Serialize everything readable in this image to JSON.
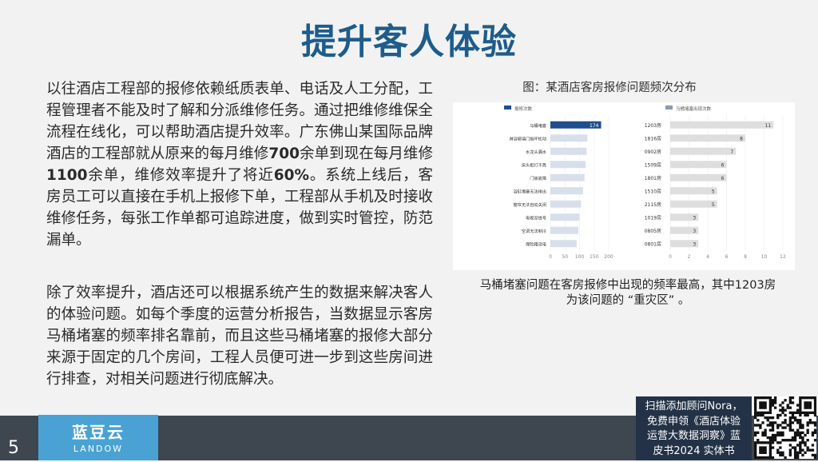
{
  "slide": {
    "title": "提升客人体验",
    "page_number": "5"
  },
  "paragraph1": {
    "t1": "以往酒店工程部的报修依赖纸质表单、电话及人工分配，工程管理者不能及时了解和分派维修任务。通过把维修维保全流程在线化，可以帮助酒店提升效率。广东佛山某国际品牌酒店的工程部就从原来的每月维修",
    "b1": "700",
    "t2": "余单到现在每月维修",
    "b2": "1100",
    "t3": "余单，维修效率提升了将近",
    "b3": "60%",
    "t4": "。系统上线后，客房员工可以直接在手机上报修下单，工程部从手机及时接收维修任务，每张工作单都可追踪进度，做到实时管控，防范漏单。"
  },
  "paragraph2": "除了效率提升，酒店还可以根据系统产生的数据来解决客人的体验问题。如每个季度的运营分析报告，当数据显示客房马桶堵塞的频率排名靠前，而且这些马桶堵塞的报修大部分来源于固定的几个房间，工程人员便可进一步到这些房间进行排查，对相关问题进行彻底解决。",
  "figure": {
    "caption": "图：某酒店客房报修问题频次分布",
    "note_line1": "马桶堵塞问题在客房报修中出现的频率最高，其中1203房",
    "note_line2": "为该问题的 “重灾区” 。"
  },
  "chart_data": [
    {
      "type": "bar",
      "orientation": "horizontal",
      "legend": "报修次数",
      "categories": [
        "马桶堵塞",
        "淋浴玻璃门损坏松动",
        "水龙头漏水",
        "床头柜灯不亮",
        "门锁故障",
        "浴缸堵塞无法排出",
        "窗帘无法自动关闭",
        "电视没信号",
        "空调无法制冷",
        "保险箱没电"
      ],
      "values": [
        174,
        127,
        124,
        121,
        117,
        112,
        105,
        100,
        96,
        90
      ],
      "data_labels": [
        "174",
        "",
        "",
        "",
        "",
        "",
        "",
        "",
        "",
        ""
      ],
      "xlim": [
        0,
        200
      ],
      "xticks": [
        "0",
        "50",
        "100",
        "150",
        "200"
      ],
      "colors": {
        "highlight": "#1e4f8c",
        "bar": "#d7dfeb"
      }
    },
    {
      "type": "bar",
      "orientation": "horizontal",
      "legend": "马桶堵塞出现次数",
      "categories": [
        "1203房",
        "1816房",
        "0902房",
        "1509房",
        "1801房",
        "1510房",
        "2115房",
        "1019房",
        "0805房",
        "0801房"
      ],
      "values": [
        11,
        8,
        7,
        6,
        6,
        5,
        5,
        3,
        3,
        3
      ],
      "data_labels": [
        "11",
        "8",
        "7",
        "6",
        "6",
        "5",
        "5",
        "3",
        "3",
        "3"
      ],
      "xlim": [
        0,
        12
      ],
      "xticks": [
        "0",
        "2",
        "4",
        "6",
        "8",
        "10",
        "12"
      ],
      "colors": {
        "bar": "#dedede"
      }
    }
  ],
  "footer": {
    "logo_cn": "蓝豆云",
    "logo_en": "LANDOW",
    "promo_lines": [
      "扫描添加顾问Nora，",
      "免费申领《酒店体验",
      "运营大数据洞察》蓝",
      "皮书2024 实体书"
    ]
  }
}
